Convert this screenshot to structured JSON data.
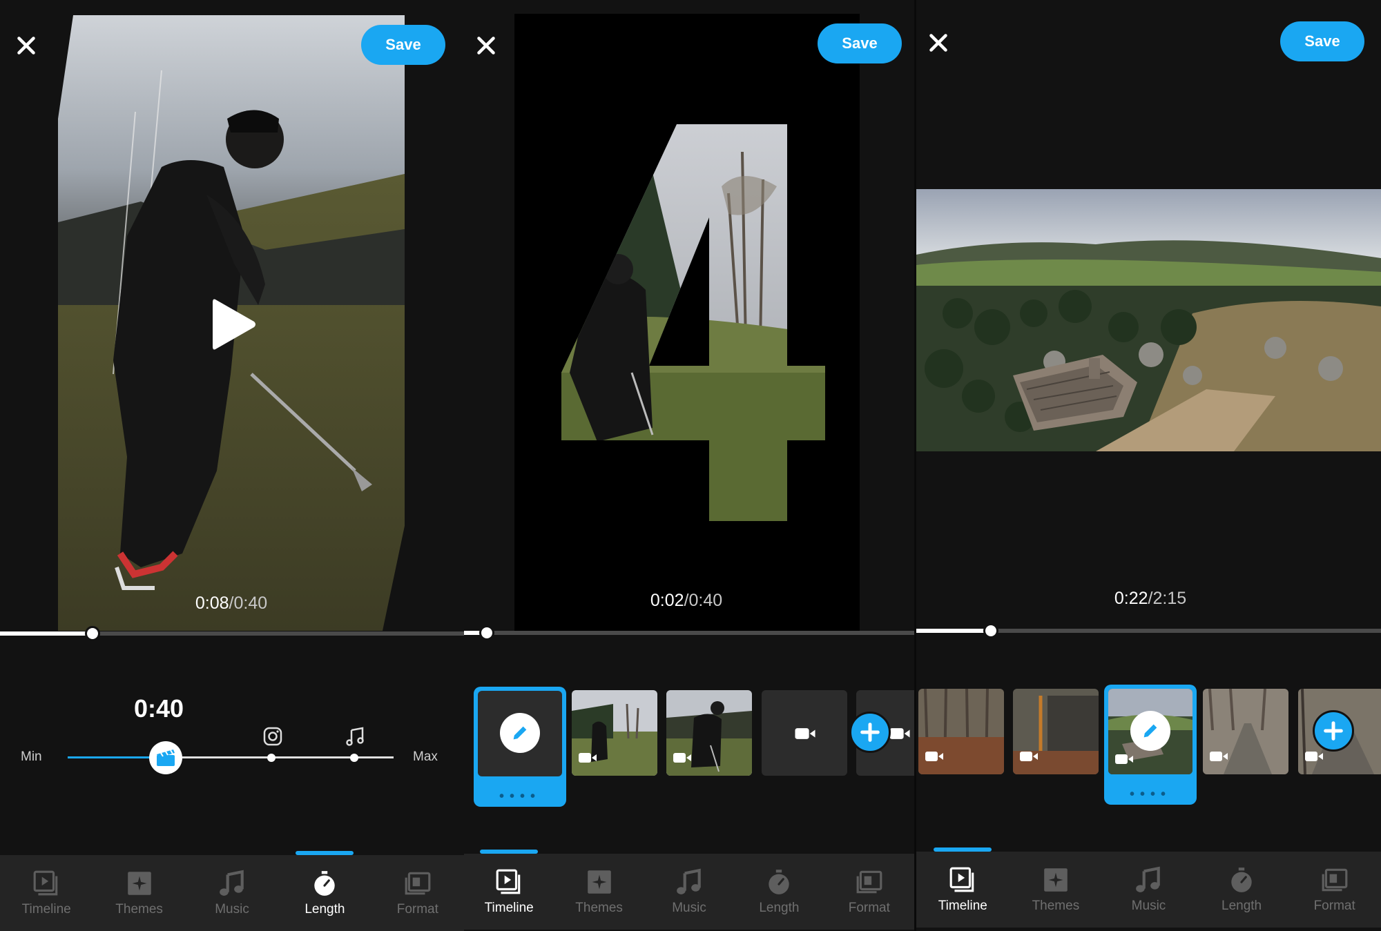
{
  "accent_color": "#1aa7f2",
  "panels": [
    {
      "close_icon": "close-icon",
      "save_label": "Save",
      "time_current": "0:08",
      "time_total": "/0:40",
      "playback_progress": 0.2,
      "length": {
        "value": "0:40",
        "min_label": "Min",
        "max_label": "Max",
        "position": 0.3,
        "marks": [
          "instagram-icon",
          "music-note-icon"
        ]
      },
      "nav": [
        {
          "label": "Timeline",
          "icon": "timeline-icon",
          "active": false
        },
        {
          "label": "Themes",
          "icon": "themes-icon",
          "active": false
        },
        {
          "label": "Music",
          "icon": "music-icon",
          "active": false
        },
        {
          "label": "Length",
          "icon": "stopwatch-icon",
          "active": true
        },
        {
          "label": "Format",
          "icon": "format-icon",
          "active": false
        }
      ]
    },
    {
      "close_icon": "close-icon",
      "save_label": "Save",
      "time_current": "0:02",
      "time_total": "/0:40",
      "playback_progress": 0.05,
      "nav": [
        {
          "label": "Timeline",
          "icon": "timeline-icon",
          "active": true
        },
        {
          "label": "Themes",
          "icon": "themes-icon",
          "active": false
        },
        {
          "label": "Music",
          "icon": "music-icon",
          "active": false
        },
        {
          "label": "Length",
          "icon": "stopwatch-icon",
          "active": false
        },
        {
          "label": "Format",
          "icon": "format-icon",
          "active": false
        }
      ]
    },
    {
      "close_icon": "close-icon",
      "save_label": "Save",
      "time_current": "0:22",
      "time_total": "/2:15",
      "playback_progress": 0.16,
      "nav": [
        {
          "label": "Timeline",
          "icon": "timeline-icon",
          "active": true
        },
        {
          "label": "Themes",
          "icon": "themes-icon",
          "active": false
        },
        {
          "label": "Music",
          "icon": "music-icon",
          "active": false
        },
        {
          "label": "Length",
          "icon": "stopwatch-icon",
          "active": false
        },
        {
          "label": "Format",
          "icon": "format-icon",
          "active": false
        }
      ]
    }
  ]
}
